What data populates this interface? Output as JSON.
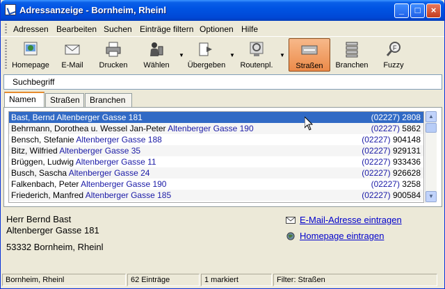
{
  "window": {
    "title": "Adressanzeige - Bornheim, Rheinl"
  },
  "menu": [
    {
      "label": "Adressen"
    },
    {
      "label": "Bearbeiten"
    },
    {
      "label": "Suchen"
    },
    {
      "label": "Einträge filtern"
    },
    {
      "label": "Optionen"
    },
    {
      "label": "Hilfe"
    }
  ],
  "toolbar": [
    {
      "label": "Homepage",
      "icon": "homepage-icon"
    },
    {
      "label": "E-Mail",
      "icon": "email-icon"
    },
    {
      "label": "Drucken",
      "icon": "printer-icon"
    },
    {
      "label": "Wählen",
      "icon": "dial-icon"
    },
    {
      "label": "Übergeben",
      "icon": "transfer-icon"
    },
    {
      "label": "Routenpl.",
      "icon": "route-icon"
    },
    {
      "label": "Straßen",
      "icon": "streets-icon"
    },
    {
      "label": "Branchen",
      "icon": "branches-icon"
    },
    {
      "label": "Fuzzy",
      "icon": "fuzzy-icon"
    }
  ],
  "search": {
    "label": "Suchbegriff",
    "value": ""
  },
  "tabs": [
    {
      "label": "Namen"
    },
    {
      "label": "Straßen"
    },
    {
      "label": "Branchen"
    }
  ],
  "entries": [
    {
      "name": "Bast, Bernd",
      "street": "Altenberger Gasse 181",
      "area": "(02227)",
      "number": "2808"
    },
    {
      "name": "Behrmann, Dorothea u. Wessel Jan-Peter",
      "street": "Altenberger Gasse 190",
      "area": "(02227)",
      "number": "5862"
    },
    {
      "name": "Bensch, Stefanie",
      "street": "Altenberger Gasse 188",
      "area": "(02227)",
      "number": "904148"
    },
    {
      "name": "Bitz, Wilfried",
      "street": "Altenberger Gasse 35",
      "area": "(02227)",
      "number": "929131"
    },
    {
      "name": "Brüggen, Ludwig",
      "street": "Altenberger Gasse 11",
      "area": "(02227)",
      "number": "933436"
    },
    {
      "name": "Busch, Sascha",
      "street": "Altenberger Gasse 24",
      "area": "(02227)",
      "number": "926628"
    },
    {
      "name": "Falkenbach, Peter",
      "street": "Altenberger Gasse 190",
      "area": "(02227)",
      "number": "3258"
    },
    {
      "name": "Friederich, Manfred",
      "street": "Altenberger Gasse 185",
      "area": "(02227)",
      "number": "900584"
    }
  ],
  "detail": {
    "line1": "Herr Bernd Bast",
    "line2": "Altenberger Gasse 181",
    "line3": "53332 Bornheim, Rheinl",
    "email_link": "E-Mail-Adresse eintragen",
    "homepage_link": "Homepage eintragen"
  },
  "status": {
    "location": "Bornheim, Rheinl",
    "count": "62 Einträge",
    "marked": "1 markiert",
    "filter": "Filter: Straßen"
  }
}
